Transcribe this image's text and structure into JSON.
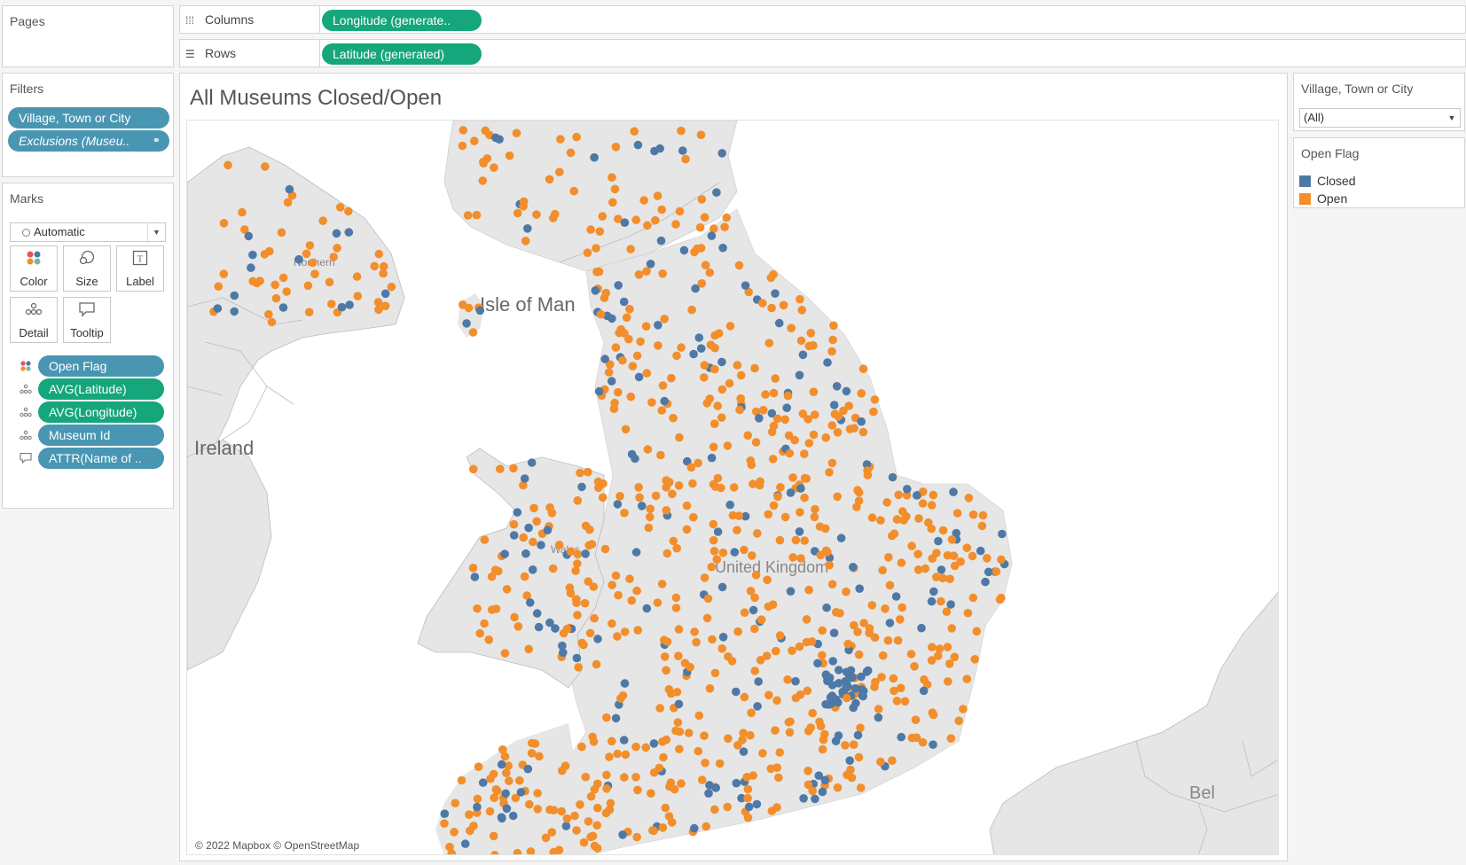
{
  "pages_card": {
    "title": "Pages"
  },
  "shelves": {
    "columns": {
      "label": "Columns",
      "icon": "columns-icon",
      "pill": "Longitude (generate.."
    },
    "rows": {
      "label": "Rows",
      "icon": "rows-icon",
      "pill": "Latitude (generated)"
    }
  },
  "filters_card": {
    "title": "Filters",
    "items": [
      {
        "label": "Village, Town or City",
        "italic": false
      },
      {
        "label": "Exclusions (Museu..",
        "italic": true
      }
    ]
  },
  "marks_card": {
    "title": "Marks",
    "mark_type": "Automatic",
    "buttons": [
      {
        "label": "Color",
        "icon": "color-icon"
      },
      {
        "label": "Size",
        "icon": "size-icon"
      },
      {
        "label": "Label",
        "icon": "label-icon"
      },
      {
        "label": "Detail",
        "icon": "detail-icon"
      },
      {
        "label": "Tooltip",
        "icon": "tooltip-icon"
      }
    ],
    "fields": [
      {
        "icon": "color-icon",
        "label": "Open Flag",
        "color": "blue"
      },
      {
        "icon": "detail-icon",
        "label": "AVG(Latitude)",
        "color": "green"
      },
      {
        "icon": "detail-icon",
        "label": "AVG(Longitude)",
        "color": "green"
      },
      {
        "icon": "detail-icon",
        "label": "Museum Id",
        "color": "blue"
      },
      {
        "icon": "tooltip-icon",
        "label": "ATTR(Name of ..",
        "color": "blue"
      }
    ]
  },
  "worksheet": {
    "title": "All Museums Closed/Open",
    "map_labels": {
      "isle_of_man": "Isle of Man",
      "ireland": "Ireland",
      "northern": "Northern",
      "wales": "Wales",
      "united_kingdom": "United Kingdom",
      "bel": "Bel"
    },
    "attribution": "© 2022 Mapbox © OpenStreetMap"
  },
  "filter_control": {
    "title": "Village, Town or City",
    "value": "(All)"
  },
  "legend": {
    "title": "Open Flag",
    "items": [
      {
        "label": "Closed",
        "color": "#4e79a7"
      },
      {
        "label": "Open",
        "color": "#f28e2b"
      }
    ]
  },
  "colors": {
    "closed": "#4e79a7",
    "open": "#f28e2b",
    "land": "#e6e6e6",
    "water": "#ffffff"
  }
}
